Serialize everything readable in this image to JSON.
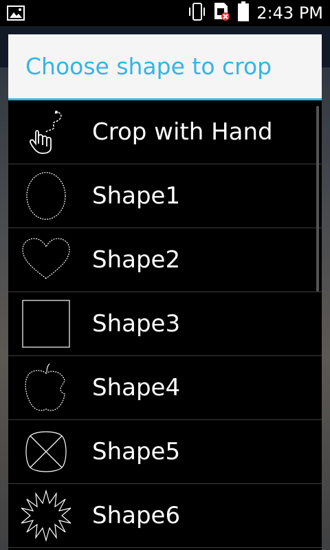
{
  "status_bar": {
    "time": "2:43 PM",
    "icons": [
      "image-icon",
      "vibrate-icon",
      "sim-error-icon",
      "battery-icon"
    ]
  },
  "dialog": {
    "title": "Choose shape to crop",
    "items": [
      {
        "label": "Crop with Hand",
        "icon": "hand-lasso-icon"
      },
      {
        "label": "Shape1",
        "icon": "oval-icon"
      },
      {
        "label": "Shape2",
        "icon": "heart-icon"
      },
      {
        "label": "Shape3",
        "icon": "square-icon"
      },
      {
        "label": "Shape4",
        "icon": "apple-icon"
      },
      {
        "label": "Shape5",
        "icon": "pinwheel-icon"
      },
      {
        "label": "Shape6",
        "icon": "starburst-icon"
      }
    ]
  },
  "colors": {
    "accent": "#33b5e5",
    "header_bg": "#f5f5f5",
    "list_bg": "#000000",
    "divider": "#3e3e3e"
  }
}
